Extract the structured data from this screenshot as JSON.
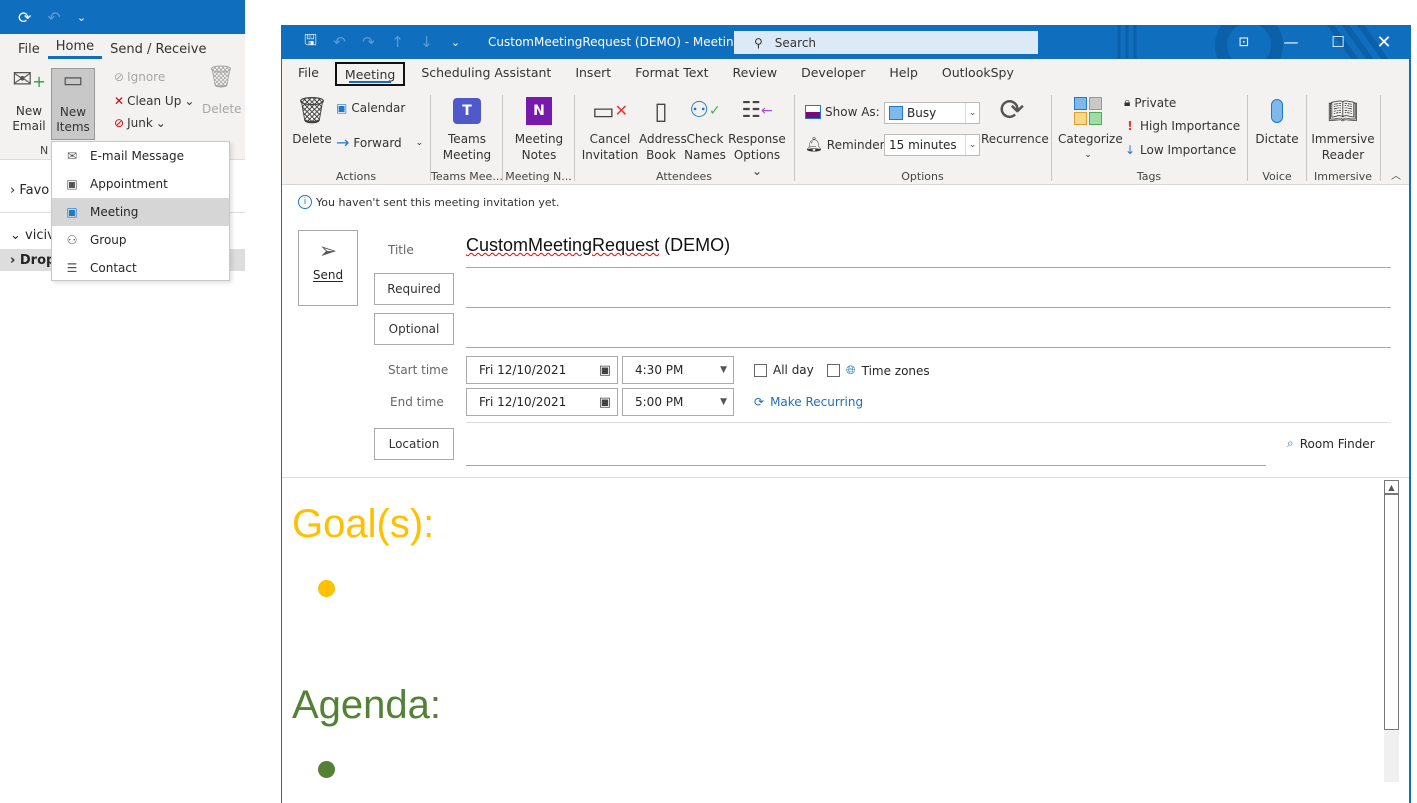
{
  "background_app": {
    "tabs": [
      "File",
      "Home",
      "Send / Receive"
    ],
    "active_tab": "Home",
    "ribbon": {
      "new_email": [
        "New",
        "Email"
      ],
      "new_items": [
        "New",
        "Items"
      ],
      "ignore": "Ignore",
      "clean_up": "Clean Up",
      "junk": "Junk",
      "delete": "Delete",
      "group_label_partial": "N"
    },
    "nav": {
      "favorites": "Favo",
      "account": "viciv",
      "drop": "Drop"
    },
    "new_items_menu": [
      {
        "label": "E-mail Message",
        "icon": "envelope-icon"
      },
      {
        "label": "Appointment",
        "icon": "calendar-icon"
      },
      {
        "label": "Meeting",
        "icon": "meeting-calendar-icon",
        "selected": true
      },
      {
        "label": "Group",
        "icon": "group-icon"
      },
      {
        "label": "Contact",
        "icon": "contact-card-icon"
      }
    ]
  },
  "window": {
    "title": "CustomMeetingRequest (DEMO)  -  Meeting",
    "search_placeholder": "Search",
    "tabs": [
      "File",
      "Meeting",
      "Scheduling Assistant",
      "Insert",
      "Format Text",
      "Review",
      "Developer",
      "Help",
      "OutlookSpy"
    ],
    "active_tab": "Meeting"
  },
  "ribbon": {
    "actions": {
      "label": "Actions",
      "delete": "Delete",
      "calendar": "Calendar",
      "forward": "Forward"
    },
    "teams": {
      "label": "Teams Mee...",
      "button": [
        "Teams",
        "Meeting"
      ]
    },
    "notes": {
      "label": "Meeting N...",
      "button": [
        "Meeting",
        "Notes"
      ]
    },
    "attendees": {
      "label": "Attendees",
      "cancel": [
        "Cancel",
        "Invitation"
      ],
      "address": [
        "Address",
        "Book"
      ],
      "check": [
        "Check",
        "Names"
      ],
      "response": [
        "Response",
        "Options"
      ]
    },
    "options": {
      "label": "Options",
      "show_as_label": "Show As:",
      "show_as_value": "Busy",
      "reminder_label": "Reminder:",
      "reminder_value": "15 minutes",
      "recurrence": "Recurrence"
    },
    "tags": {
      "label": "Tags",
      "categorize": "Categorize",
      "private": "Private",
      "high": "High Importance",
      "low": "Low Importance"
    },
    "voice": {
      "label": "Voice",
      "dictate": "Dictate"
    },
    "immersive": {
      "label": "Immersive",
      "button": [
        "Immersive",
        "Reader"
      ]
    }
  },
  "form": {
    "info": "You haven't sent this meeting invitation yet.",
    "send": "Send",
    "title_label": "Title",
    "title_value_underlined": "CustomMeetingRequest",
    "title_value_rest": " (DEMO)",
    "required": "Required",
    "optional": "Optional",
    "start_label": "Start time",
    "start_date": "Fri 12/10/2021",
    "start_time": "4:30 PM",
    "end_label": "End time",
    "end_date": "Fri 12/10/2021",
    "end_time": "5:00 PM",
    "all_day": "All day",
    "time_zones": "Time zones",
    "make_recurring": "Make Recurring",
    "location": "Location",
    "room_finder": "Room Finder"
  },
  "body": {
    "goal_heading": "Goal(s):",
    "goal_color": "#ffc000",
    "agenda_heading": "Agenda:",
    "agenda_color": "#538135"
  }
}
